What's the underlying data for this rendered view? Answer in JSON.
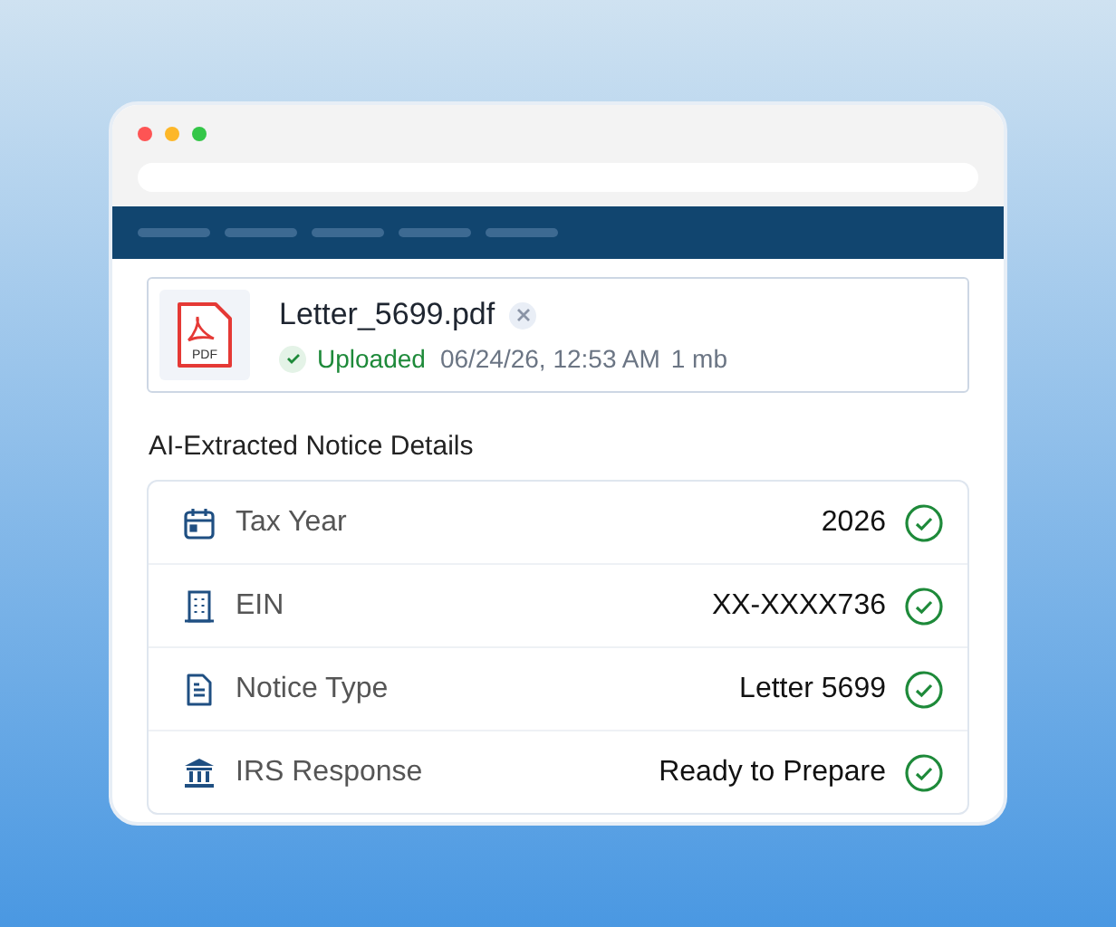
{
  "file": {
    "name": "Letter_5699.pdf",
    "icon_label": "PDF",
    "status": "Uploaded",
    "uploaded": true,
    "timestamp": "06/24/26, 12:53 AM",
    "size": "1 mb"
  },
  "section_title": "AI-Extracted Notice Details",
  "details": [
    {
      "label": "Tax Year",
      "value": "2026",
      "verified": true
    },
    {
      "label": "EIN",
      "value": "XX-XXXX736",
      "verified": true
    },
    {
      "label": "Notice Type",
      "value": "Letter 5699",
      "verified": true
    },
    {
      "label": "IRS Response",
      "value": "Ready to Prepare",
      "verified": true
    }
  ]
}
